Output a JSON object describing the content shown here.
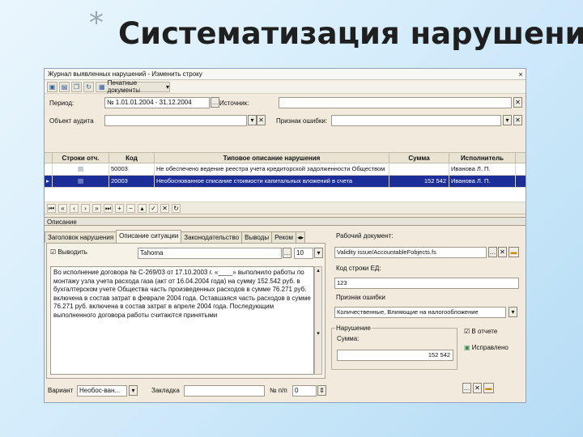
{
  "slide": {
    "star": "*",
    "title": "Систематизация нарушений"
  },
  "window": {
    "title": "Журнал выявленных нарушений - Изменить строку",
    "close": "×"
  },
  "toolbar": {
    "print_label": "Печатные документы",
    "print_arrow": "▾"
  },
  "filters": {
    "period_label": "Период:",
    "period_value": "№ 1.01.01.2004 - 31.12.2004",
    "source_label": "Источник:",
    "source_value": "",
    "object_label": "Объект аудита",
    "object_value": "",
    "sign_label": "Признак ошибки:",
    "sign_value": ""
  },
  "grid": {
    "columns": [
      "Строки отч.",
      "Код",
      "Типовое описание нарушения",
      "Сумма",
      "Исполнитель"
    ],
    "rows": [
      {
        "code": "50003",
        "description": "Не обеспечено ведение реестра учета кредиторской задолженности Обществом",
        "sum": "",
        "executor": "Иванова Л. П.",
        "selected": false
      },
      {
        "code": "20003",
        "description": "Необоснованное списание стоимости капитальных вложений в счета",
        "sum": "152 542",
        "executor": "Иванова Л. П.",
        "selected": true
      }
    ]
  },
  "description": {
    "section_label": "Описание",
    "tabs": [
      "Заголовок нарушения",
      "Описание ситуации",
      "Законодательство",
      "Выводы",
      "Реком"
    ],
    "active_tab": 1,
    "output_label": "Выводить",
    "font_value": "Tahoma",
    "size_value": "10",
    "text": "Во исполнение договора № С-269/03 от 17.10.2003 г. «____» выполнило работы по монтажу узла учета расхода газа (акт от 16.04.2004 года) на сумму 152.542 руб. в бухгалтерском учете Общества часть произведенных расходов в сумме 76.271 руб. включена в состав затрат в феврале 2004 года. Оставшаяся часть расходов в сумме 76.271 руб. включена в состав затрат в апреле 2004 года. Последующим выполненного договора работы считаются принятыми"
  },
  "right_panel": {
    "work_doc_label": "Рабочий документ:",
    "work_doc_value": "Validity issue/AccountableFobjects.fs",
    "row_code_label": "Код строки ЕД:",
    "row_code_value": "123",
    "error_sign_label": "Признак ошибки",
    "error_sign_value": "Количественные, Влияющие на налогообложение",
    "violation_label": "Нарушение",
    "sum_label": "Сумма:",
    "sum_value": "152 542",
    "in_report_label": "В отчете",
    "fixed_label": "Исправлено"
  },
  "bottom": {
    "variant_label": "Вариант",
    "variant_value": "Необос-ван...",
    "bookmark_label": "Закладка",
    "bookmark_value": "",
    "num_label": "№ п/п",
    "num_value": "0"
  }
}
